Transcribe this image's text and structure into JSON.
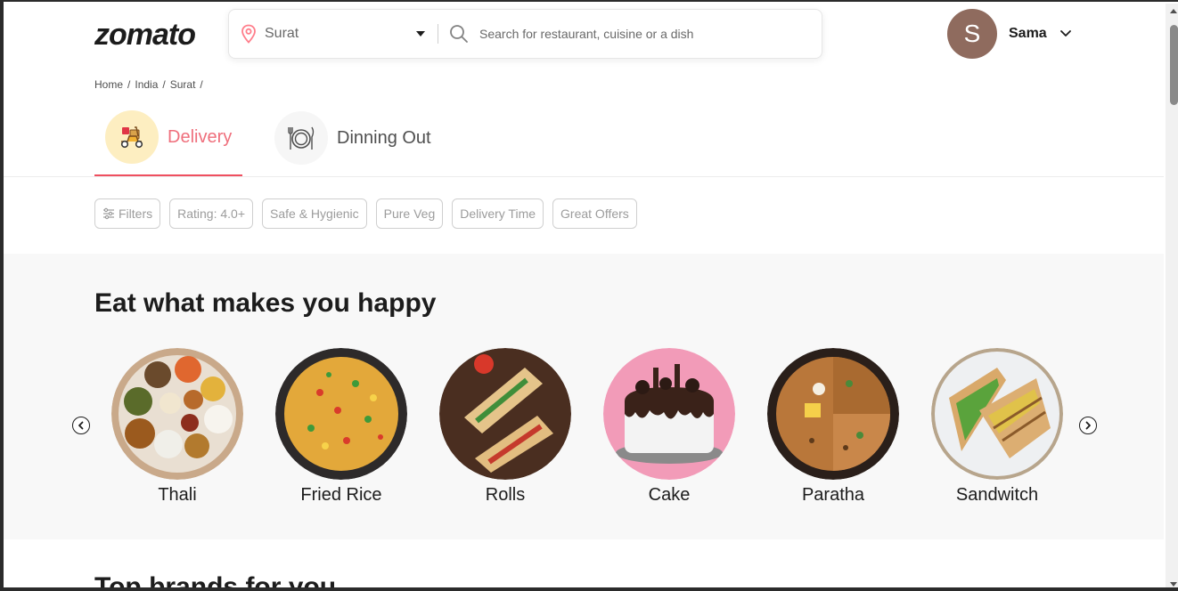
{
  "header": {
    "logo": "zomato",
    "location": "Surat",
    "search_placeholder": "Search for restaurant, cuisine or a dish",
    "avatar_initial": "S",
    "username": "Sama"
  },
  "breadcrumb": [
    "Home",
    "/",
    "India",
    "/",
    "Surat",
    "/"
  ],
  "tabs": [
    {
      "label": "Delivery",
      "active": true,
      "icon": "delivery-scooter-icon"
    },
    {
      "label": "Dinning Out",
      "active": false,
      "icon": "dining-plate-icon"
    }
  ],
  "filters": [
    "Filters",
    "Rating: 4.0+",
    "Safe & Hygienic",
    "Pure Veg",
    "Delivery Time",
    "Great Offers"
  ],
  "section": {
    "title": "Eat what makes you happy",
    "items": [
      "Thali",
      "Fried Rice",
      "Rolls",
      "Cake",
      "Paratha",
      "Sandwitch"
    ]
  },
  "next_section_title": "Top brands for you",
  "colors": {
    "accent": "#ef4f5f",
    "avatar": "#8f6b5e",
    "section_bg": "#f8f8f8"
  }
}
